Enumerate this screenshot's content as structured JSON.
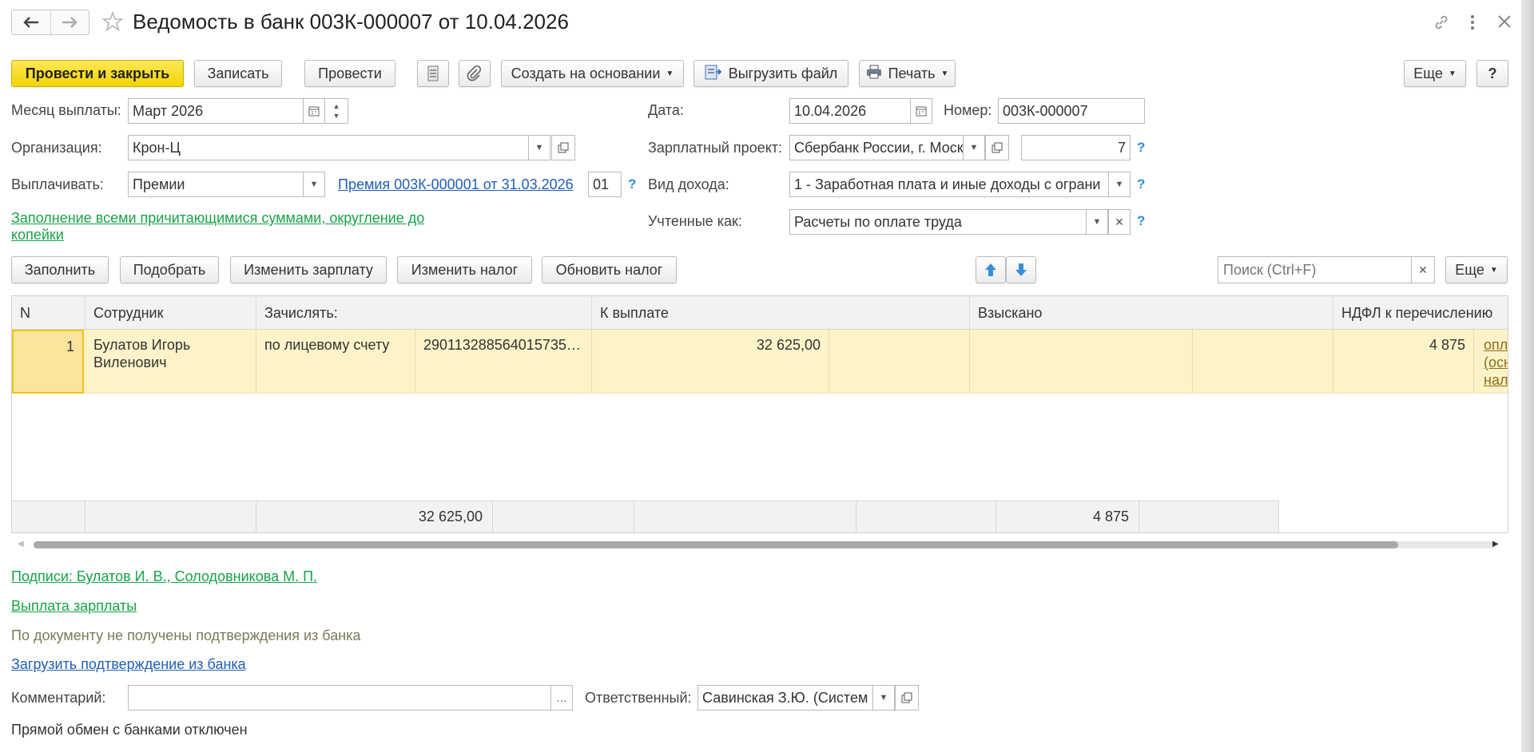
{
  "window": {
    "title": "Ведомость в банк 003К-000007 от 10.04.2026"
  },
  "toolbar": {
    "post_close": "Провести и закрыть",
    "save": "Записать",
    "post": "Провести",
    "create_based": "Создать на основании",
    "export_file": "Выгрузить файл",
    "print": "Печать",
    "more": "Еще",
    "help": "?"
  },
  "form": {
    "month_label": "Месяц выплаты:",
    "month_value": "Март 2026",
    "date_label": "Дата:",
    "date_value": "10.04.2026",
    "number_label": "Номер:",
    "number_value": "003К-000007",
    "org_label": "Организация:",
    "org_value": "Крон-Ц",
    "salary_project_label": "Зарплатный проект:",
    "salary_project_value": "Сбербанк России, г. Моск",
    "salary_project_number": "7",
    "pay_label": "Выплачивать:",
    "pay_value": "Премии",
    "bonus_link": "Премия 003К-000001 от 31.03.2026",
    "bonus_num": "01",
    "income_label": "Вид дохода:",
    "income_value": "1 - Заработная плата и иные доходы с ограни",
    "accounted_label": "Учтенные как:",
    "accounted_value": "Расчеты по оплате труда",
    "fill_link_line1": "Заполнение всеми причитающимися суммами, округление до",
    "fill_link_line2": "копейки",
    "help": "?"
  },
  "table_toolbar": {
    "fill": "Заполнить",
    "select": "Подобрать",
    "change_salary": "Изменить зарплату",
    "change_tax": "Изменить налог",
    "update_tax": "Обновить налог",
    "search_placeholder": "Поиск (Ctrl+F)",
    "more": "Еще"
  },
  "table": {
    "headers": {
      "n": "N",
      "employee": "Сотрудник",
      "credit_to": "Зачислять:",
      "to_pay": "К выплате",
      "collected": "Взыскано",
      "ndfl": "НДФЛ к перечислению"
    },
    "rows": [
      {
        "n": "1",
        "employee_line1": "Булатов Игорь",
        "employee_line2": "Виленович",
        "credit_type": "по лицевому счету",
        "account": "290113288564015735…",
        "to_pay": "32 625,00",
        "ndfl": "4 875",
        "extra_line1": "опл",
        "extra_line2": "(осн",
        "extra_line3": "нал"
      }
    ],
    "footer": {
      "to_pay_total": "32 625,00",
      "ndfl_total": "4 875"
    }
  },
  "bottom": {
    "signatures_link": "Подписи: Булатов И. В., Солодовникова М. П.",
    "salary_payment_link": "Выплата зарплаты",
    "no_confirmations": "По документу не получены подтверждения из банка",
    "load_confirmation_link": "Загрузить подтверждение из банка",
    "comment_label": "Комментарий:",
    "comment_value": "",
    "responsible_label": "Ответственный:",
    "responsible_value": "Савинская З.Ю. (Систем",
    "exchange_status": "Прямой обмен с банками отключен"
  },
  "colors": {
    "primary_button": "#f3d400",
    "selected_row": "#fdf3c9",
    "link_green": "#17a346",
    "link_blue": "#1f5fb8",
    "help_blue": "#2a8fd6"
  }
}
